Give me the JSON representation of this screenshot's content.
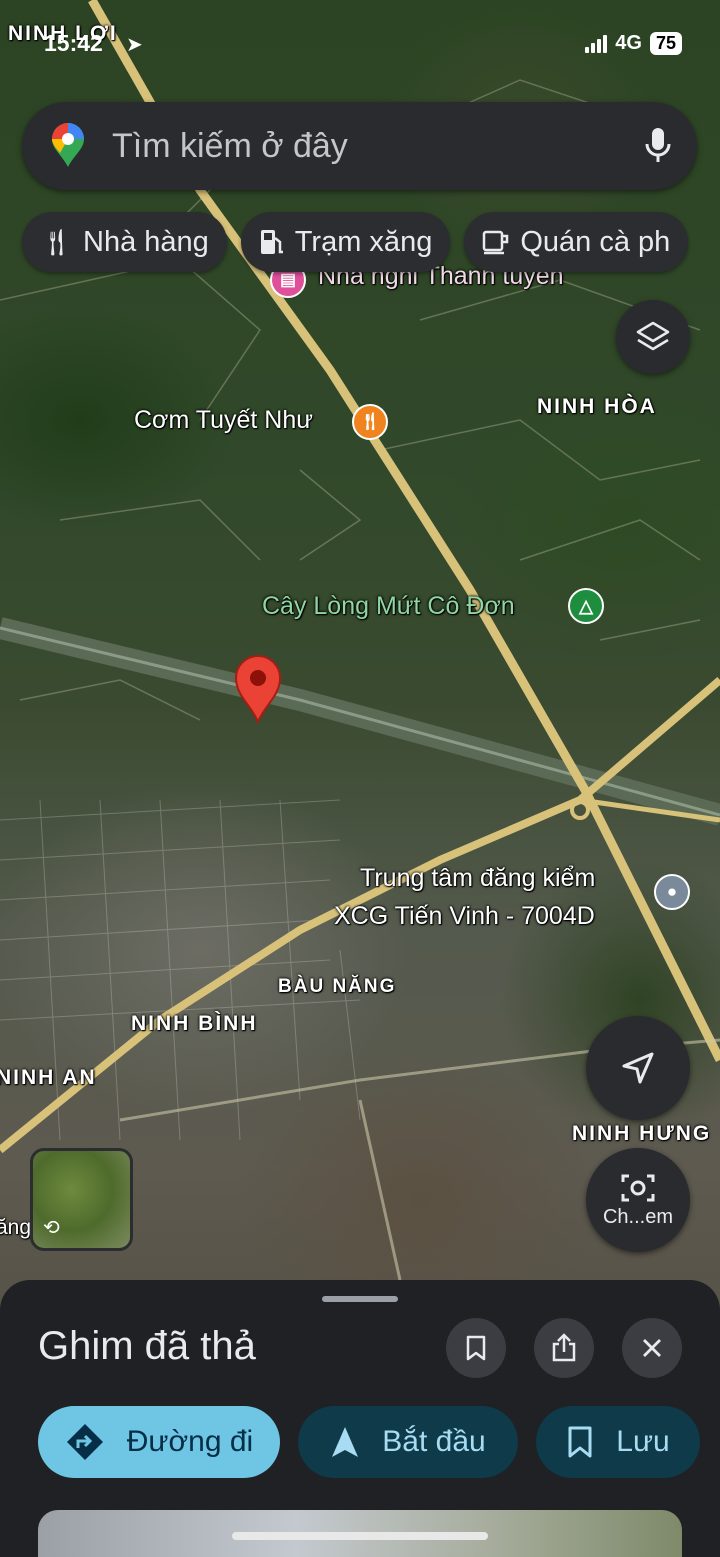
{
  "status_bar": {
    "time": "15:42",
    "network": "4G",
    "battery": "75"
  },
  "search": {
    "placeholder": "Tìm kiếm ở đây"
  },
  "chips": [
    {
      "label": "Nhà hàng",
      "icon": "restaurant-icon"
    },
    {
      "label": "Trạm xăng",
      "icon": "gas-station-icon"
    },
    {
      "label": "Quán cà ph",
      "icon": "coffee-icon"
    }
  ],
  "map": {
    "area_labels": {
      "ninh_loi": "NINH LỢI",
      "ninh_hoa": "NINH HÒA",
      "bau_nang": "BÀU NĂNG",
      "ninh_binh": "NINH BÌNH",
      "ninh_an": "NINH AN",
      "ninh_hung": "NINH HƯNG",
      "partial_left": "ăng"
    },
    "pois": {
      "nha_nghi": "Nhà nghỉ Thanh tuyền",
      "com": "Cơm Tuyết Như",
      "cay_long": "Cây Lòng Mứt Cô Đơn",
      "trung_tam_line1": "Trung tâm đăng kiểm",
      "trung_tam_line2": "XCG Tiến Vinh - 7004D"
    },
    "colors": {
      "road": "#d8c27a",
      "pin": "#ea4335",
      "poi_green": "#1e8e3e",
      "poi_orange": "#f0831e",
      "poi_pink": "#e0509a"
    }
  },
  "lens": {
    "label": "Ch...em"
  },
  "sheet": {
    "title": "Ghim đã thả",
    "actions": {
      "directions": "Đường đi",
      "start": "Bắt đầu",
      "save": "Lưu"
    }
  }
}
